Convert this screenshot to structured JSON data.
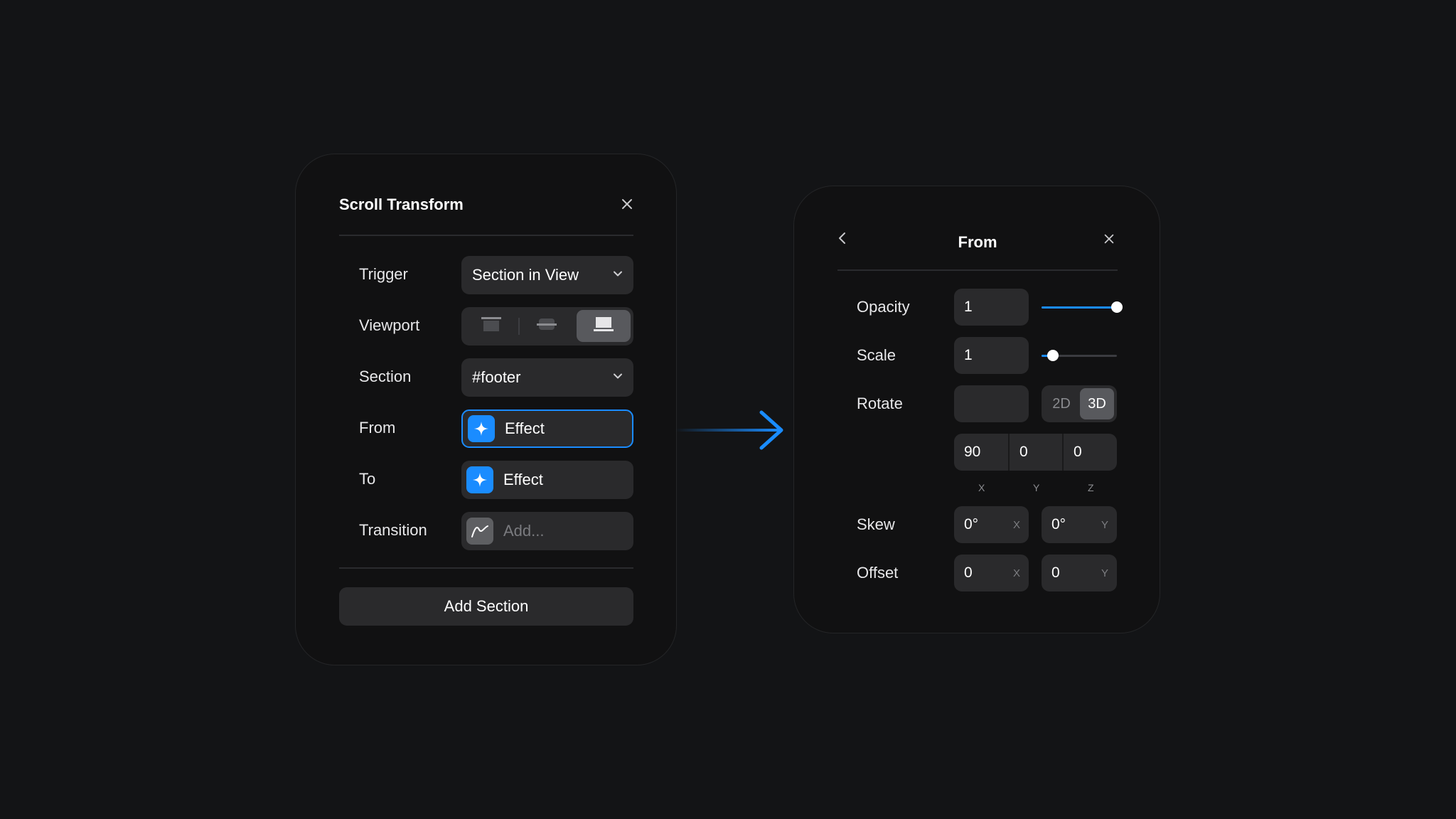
{
  "scroll_transform": {
    "title": "Scroll Transform",
    "close_icon": "close-icon",
    "rows": {
      "trigger": {
        "label": "Trigger",
        "value": "Section in View"
      },
      "viewport": {
        "label": "Viewport",
        "options": [
          "viewport-top-icon",
          "viewport-center-icon",
          "viewport-bottom-icon"
        ],
        "selected_index": 2
      },
      "section": {
        "label": "Section",
        "value": "#footer"
      },
      "from": {
        "label": "From",
        "value": "Effect"
      },
      "to": {
        "label": "To",
        "value": "Effect"
      },
      "transition": {
        "label": "Transition",
        "placeholder": "Add..."
      }
    },
    "add_button": "Add Section"
  },
  "from_panel": {
    "title": "From",
    "back_icon": "chevron-left-icon",
    "close_icon": "close-icon",
    "opacity": {
      "label": "Opacity",
      "value": "1",
      "slider_fraction": 1.0
    },
    "scale": {
      "label": "Scale",
      "value": "1",
      "slider_fraction": 0.15
    },
    "rotate": {
      "label": "Rotate",
      "value": "",
      "mode_options": [
        "2D",
        "3D"
      ],
      "selected_mode": "3D",
      "x": "90",
      "y": "0",
      "z": "0",
      "axis_labels": [
        "X",
        "Y",
        "Z"
      ]
    },
    "skew": {
      "label": "Skew",
      "x": "0°",
      "y": "0°",
      "x_suffix": "X",
      "y_suffix": "Y"
    },
    "offset": {
      "label": "Offset",
      "x": "0",
      "y": "0",
      "x_suffix": "X",
      "y_suffix": "Y"
    }
  },
  "colors": {
    "accent": "#1a8cff",
    "background": "#131416",
    "panel": "#111112",
    "control": "#2a2a2c"
  }
}
